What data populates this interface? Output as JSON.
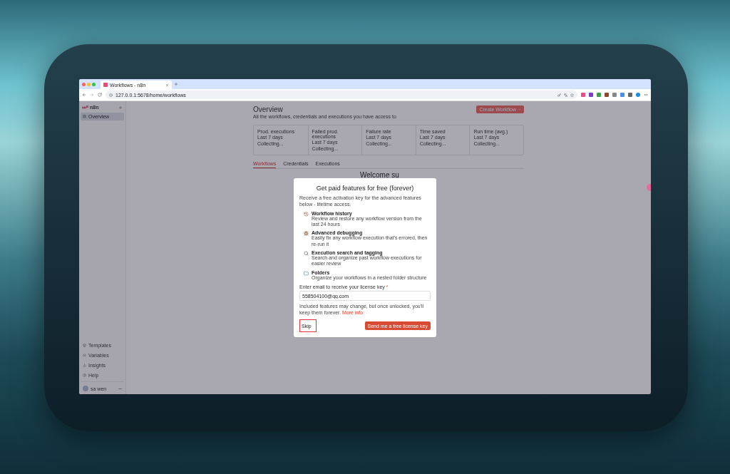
{
  "browser": {
    "tab": {
      "title": "Workflows - n8n"
    },
    "url": "127.0.0.1:5678/home/workflows"
  },
  "sidebar": {
    "brand": "n8n",
    "items": [
      {
        "label": "Overview",
        "selected": true
      }
    ],
    "bottom_items": [
      {
        "label": "Templates",
        "kind": "templates"
      },
      {
        "label": "Variables",
        "kind": "variables"
      },
      {
        "label": "Insights",
        "kind": "insights"
      },
      {
        "label": "Help",
        "kind": "help"
      }
    ],
    "user": "sa wen"
  },
  "main": {
    "title": "Overview",
    "subtitle": "All the workflows, credentials and executions you have access to",
    "create_button": "Create Workflow",
    "stats": [
      {
        "label": "Prod. executions",
        "period": "Last 7 days",
        "value": "Collecting..."
      },
      {
        "label": "Failed prod. executions",
        "period": "Last 7 days",
        "value": "Collecting..."
      },
      {
        "label": "Failure rate",
        "period": "Last 7 days",
        "value": "Collecting..."
      },
      {
        "label": "Time saved",
        "period": "Last 7 days",
        "value": "Collecting..."
      },
      {
        "label": "Run time (avg.)",
        "period": "Last 7 days",
        "value": "Collecting..."
      }
    ],
    "tabs": [
      {
        "label": "Workflows",
        "selected": true
      },
      {
        "label": "Credentials",
        "selected": false
      },
      {
        "label": "Executions",
        "selected": false
      }
    ],
    "welcome": "Welcome su"
  },
  "modal": {
    "title": "Get paid features for free (forever)",
    "intro": "Receive a free activation key for the advanced features below - lifetime access.",
    "features": [
      {
        "kind": "history",
        "title": "Workflow history",
        "description": "Review and restore any workflow version from the last 24 hours"
      },
      {
        "kind": "debug",
        "title": "Advanced debugging",
        "description": "Easily fix any workflow execution that's errored, then re-run it"
      },
      {
        "kind": "search",
        "title": "Execution search and tagging",
        "description": "Search and organize past workflow executions for easier review"
      },
      {
        "kind": "folders",
        "title": "Folders",
        "description": "Organize your workflows in a nested folder structure"
      }
    ],
    "email_label": "Enter email to receive your license key",
    "required_mark": "*",
    "email": "558504100@qq.com",
    "note": "Included features may change, but once unlocked, you'll keep them forever.",
    "note_link": "More info",
    "skip": {
      "label": "Skip",
      "highlighted": true
    },
    "submit": "Send me a free license key"
  }
}
